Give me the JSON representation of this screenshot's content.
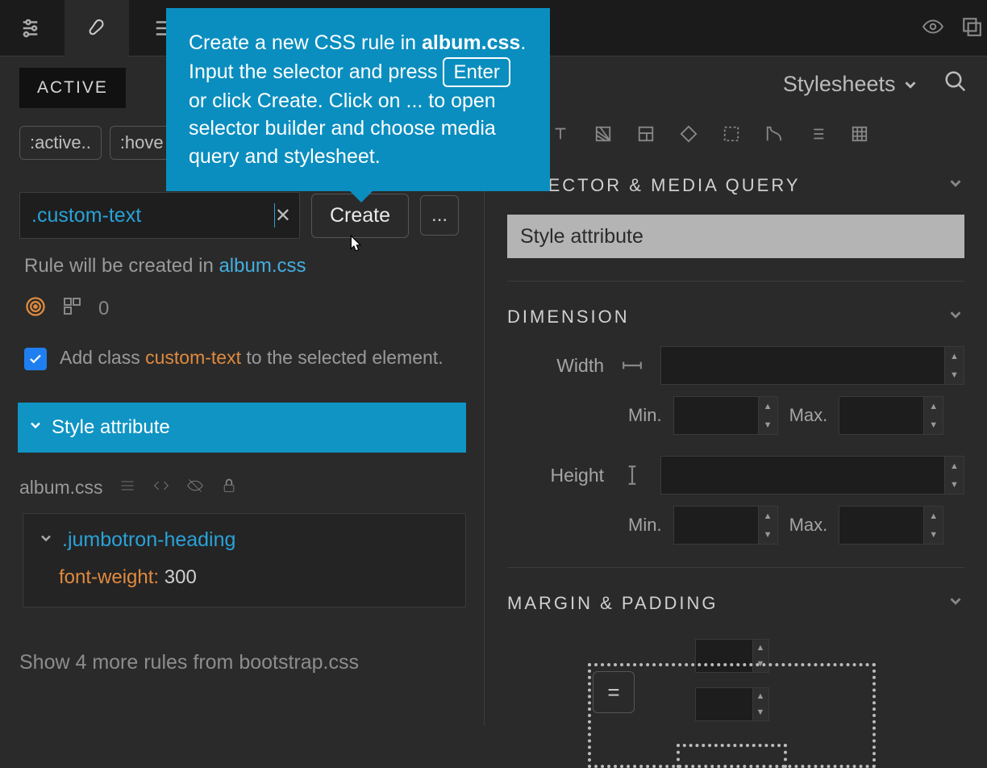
{
  "topbar": {},
  "left": {
    "tab_active": "ACTIVE",
    "pseudo": {
      "active": ":active..",
      "hover": ":hove"
    },
    "selector_value": ".custom-text",
    "create_label": "Create",
    "dots": "...",
    "helper_prefix": "Rule will be created in ",
    "helper_link": "album.css",
    "grid_count": "0",
    "checkbox": {
      "pre": "Add class ",
      "class": "custom-text",
      "post": " to the selected element."
    },
    "style_attr_bar": "Style attribute",
    "file_name": "album.css",
    "rule": {
      "selector": ".jumbotron-heading",
      "prop": "font-weight:",
      "value": "300"
    },
    "show_more": "Show 4 more rules from bootstrap.css"
  },
  "right": {
    "stylesheets_label": "Stylesheets",
    "section_selector": "SELECTOR & MEDIA QUERY",
    "grey_bar": "Style attribute",
    "section_dimension": "DIMENSION",
    "width": "Width",
    "height": "Height",
    "min": "Min.",
    "max": "Max.",
    "section_margin": "MARGIN & PADDING",
    "eq": "="
  },
  "tooltip": {
    "pre1": "Create a new CSS rule in ",
    "bold": "album.css",
    "post1": ". Input the selector and press ",
    "kbd": "Enter",
    "post2": " or click Create. Click on ... to open selector builder and choose media query and stylesheet."
  }
}
